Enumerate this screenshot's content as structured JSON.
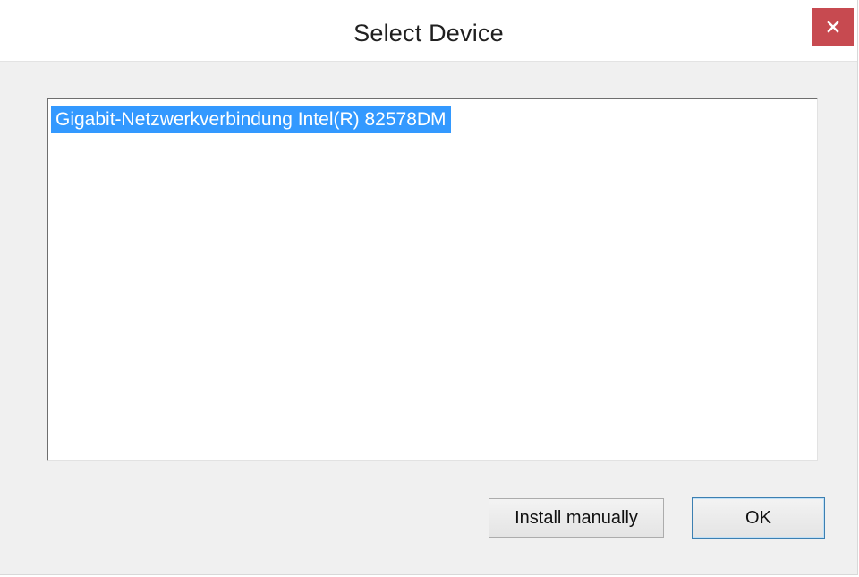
{
  "window": {
    "title": "Select Device",
    "close_icon": "close-icon",
    "close_color": "#c74a50"
  },
  "device_list": {
    "items": [
      {
        "label": "Gigabit-Netzwerkverbindung Intel(R) 82578DM",
        "selected": true
      }
    ],
    "selection_color": "#3399ff"
  },
  "buttons": {
    "install_label": "Install manually",
    "ok_label": "OK"
  }
}
